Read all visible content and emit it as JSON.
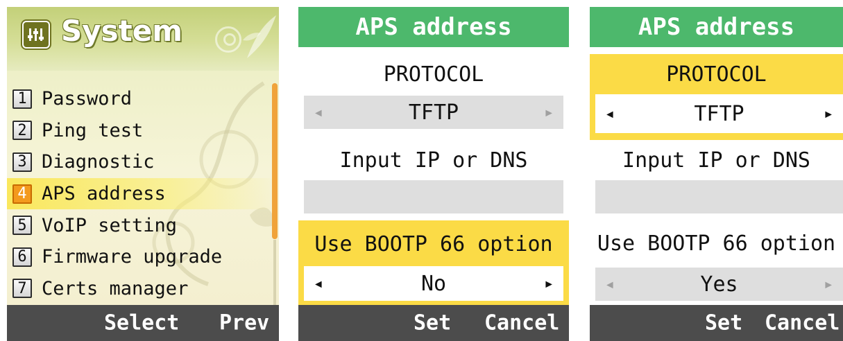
{
  "screen1": {
    "title": "System",
    "icon": "equalizer-icon",
    "items": [
      {
        "num": "1",
        "label": "Password"
      },
      {
        "num": "2",
        "label": "Ping test"
      },
      {
        "num": "3",
        "label": "Diagnostic"
      },
      {
        "num": "4",
        "label": "APS address"
      },
      {
        "num": "5",
        "label": "VoIP setting"
      },
      {
        "num": "6",
        "label": "Firmware upgrade"
      },
      {
        "num": "7",
        "label": "Certs manager"
      }
    ],
    "selected_index": 3,
    "softkeys": {
      "left": "Select",
      "right": "Prev"
    }
  },
  "screen2": {
    "title": "APS address",
    "protocol_label": "PROTOCOL",
    "protocol_value": "TFTP",
    "ip_label": "Input IP or DNS",
    "ip_value": "",
    "bootp_label": "Use BOOTP 66 option",
    "bootp_value": "No",
    "focused": "bootp",
    "softkeys": {
      "left": "Set",
      "right": "Cancel"
    }
  },
  "screen3": {
    "title": "APS address",
    "protocol_label": "PROTOCOL",
    "protocol_value": "TFTP",
    "ip_label": "Input IP or DNS",
    "ip_value": "",
    "bootp_label": "Use BOOTP 66 option",
    "bootp_value": "Yes",
    "focused": "protocol",
    "softkeys": {
      "left": "Set",
      "right": "Cancel"
    }
  },
  "colors": {
    "header_green": "#4db86c",
    "focus_yellow": "#fbdb46",
    "softbar_gray": "#4c4c4c",
    "field_gray": "#dedede",
    "menu_highlight_orange": "#f39a1d"
  }
}
